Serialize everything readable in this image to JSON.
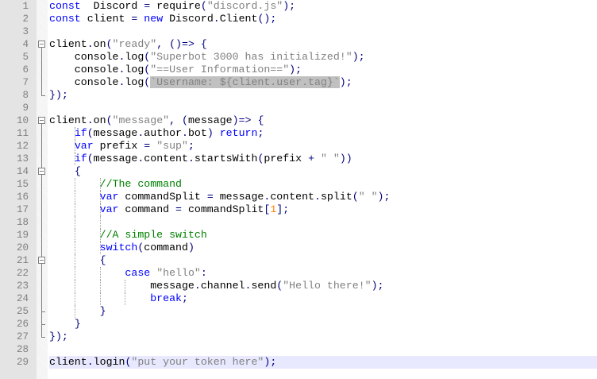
{
  "editor": {
    "current_line": 29,
    "colors": {
      "keyword": "#0000ff",
      "operator": "#000080",
      "string": "#808080",
      "comment": "#008000",
      "number": "#ff8000",
      "current_line_bg": "#e8e8ff",
      "selection": "#c0c0c0"
    },
    "lines": [
      {
        "n": "1",
        "fold": "",
        "tokens": [
          [
            "k",
            "const"
          ],
          [
            "",
            "  Discord "
          ],
          [
            "o",
            "="
          ],
          [
            "",
            " require"
          ],
          [
            "o",
            "("
          ],
          [
            "s",
            "\"discord.js\""
          ],
          [
            "o",
            ");"
          ]
        ]
      },
      {
        "n": "2",
        "fold": "",
        "tokens": [
          [
            "k",
            "const"
          ],
          [
            "",
            " client "
          ],
          [
            "o",
            "="
          ],
          [
            "",
            " "
          ],
          [
            "k",
            "new"
          ],
          [
            "",
            " Discord"
          ],
          [
            "o",
            "."
          ],
          [
            "",
            "Client"
          ],
          [
            "o",
            "();"
          ]
        ]
      },
      {
        "n": "3",
        "fold": "",
        "tokens": []
      },
      {
        "n": "4",
        "fold": "open",
        "tokens": [
          [
            "",
            "client"
          ],
          [
            "o",
            "."
          ],
          [
            "",
            "on"
          ],
          [
            "o",
            "("
          ],
          [
            "s",
            "\"ready\""
          ],
          [
            "o",
            ","
          ],
          [
            "",
            " "
          ],
          [
            "o",
            "()=>"
          ],
          [
            "",
            " "
          ],
          [
            "o",
            "{"
          ]
        ]
      },
      {
        "n": "5",
        "fold": "line",
        "tokens": [
          [
            "",
            "    console"
          ],
          [
            "o",
            "."
          ],
          [
            "",
            "log"
          ],
          [
            "o",
            "("
          ],
          [
            "s",
            "\"Superbot 3000 has initialized!\""
          ],
          [
            "o",
            ");"
          ]
        ]
      },
      {
        "n": "6",
        "fold": "line",
        "tokens": [
          [
            "",
            "    console"
          ],
          [
            "o",
            "."
          ],
          [
            "",
            "log"
          ],
          [
            "o",
            "("
          ],
          [
            "s",
            "\"==User Information==\""
          ],
          [
            "o",
            ");"
          ]
        ]
      },
      {
        "n": "7",
        "fold": "line",
        "tokens": [
          [
            "",
            "    console"
          ],
          [
            "o",
            "."
          ],
          [
            "",
            "log"
          ],
          [
            "o",
            "("
          ],
          [
            "hl s",
            "`Username: ${client.user.tag}`"
          ],
          [
            "o",
            ");"
          ]
        ]
      },
      {
        "n": "8",
        "fold": "end",
        "tokens": [
          [
            "o",
            "});"
          ]
        ]
      },
      {
        "n": "9",
        "fold": "",
        "tokens": []
      },
      {
        "n": "10",
        "fold": "open",
        "tokens": [
          [
            "",
            "client"
          ],
          [
            "o",
            "."
          ],
          [
            "",
            "on"
          ],
          [
            "o",
            "("
          ],
          [
            "s",
            "\"message\""
          ],
          [
            "o",
            ","
          ],
          [
            "",
            " "
          ],
          [
            "o",
            "("
          ],
          [
            "",
            "message"
          ],
          [
            "o",
            ")=>"
          ],
          [
            "",
            " "
          ],
          [
            "o",
            "{"
          ]
        ]
      },
      {
        "n": "11",
        "fold": "line",
        "tokens": [
          [
            "",
            "    "
          ],
          [
            "k",
            "if"
          ],
          [
            "o",
            "("
          ],
          [
            "",
            "message"
          ],
          [
            "o",
            "."
          ],
          [
            "",
            "author"
          ],
          [
            "o",
            "."
          ],
          [
            "",
            "bot"
          ],
          [
            "o",
            ")"
          ],
          [
            "",
            " "
          ],
          [
            "k",
            "return"
          ],
          [
            "o",
            ";"
          ]
        ]
      },
      {
        "n": "12",
        "fold": "line",
        "tokens": [
          [
            "",
            "    "
          ],
          [
            "k",
            "var"
          ],
          [
            "",
            " prefix "
          ],
          [
            "o",
            "="
          ],
          [
            "",
            " "
          ],
          [
            "s",
            "\"sup\""
          ],
          [
            "o",
            ";"
          ]
        ]
      },
      {
        "n": "13",
        "fold": "line",
        "tokens": [
          [
            "",
            "    "
          ],
          [
            "k",
            "if"
          ],
          [
            "o",
            "("
          ],
          [
            "",
            "message"
          ],
          [
            "o",
            "."
          ],
          [
            "",
            "content"
          ],
          [
            "o",
            "."
          ],
          [
            "",
            "startsWith"
          ],
          [
            "o",
            "("
          ],
          [
            "",
            "prefix "
          ],
          [
            "o",
            "+"
          ],
          [
            "",
            " "
          ],
          [
            "s",
            "\" \""
          ],
          [
            "o",
            "))"
          ]
        ]
      },
      {
        "n": "14",
        "fold": "open",
        "tokens": [
          [
            "",
            "    "
          ],
          [
            "o",
            "{"
          ]
        ]
      },
      {
        "n": "15",
        "fold": "line",
        "tokens": [
          [
            "",
            "        "
          ],
          [
            "c",
            "//The command"
          ]
        ]
      },
      {
        "n": "16",
        "fold": "line",
        "tokens": [
          [
            "",
            "        "
          ],
          [
            "k",
            "var"
          ],
          [
            "",
            " commandSplit "
          ],
          [
            "o",
            "="
          ],
          [
            "",
            " message"
          ],
          [
            "o",
            "."
          ],
          [
            "",
            "content"
          ],
          [
            "o",
            "."
          ],
          [
            "",
            "split"
          ],
          [
            "o",
            "("
          ],
          [
            "s",
            "\" \""
          ],
          [
            "o",
            ");"
          ]
        ]
      },
      {
        "n": "17",
        "fold": "line",
        "tokens": [
          [
            "",
            "        "
          ],
          [
            "k",
            "var"
          ],
          [
            "",
            " command "
          ],
          [
            "o",
            "="
          ],
          [
            "",
            " commandSplit"
          ],
          [
            "o",
            "["
          ],
          [
            "n",
            "1"
          ],
          [
            "o",
            "];"
          ]
        ]
      },
      {
        "n": "18",
        "fold": "line",
        "tokens": []
      },
      {
        "n": "19",
        "fold": "line",
        "tokens": [
          [
            "",
            "        "
          ],
          [
            "c",
            "//A simple switch"
          ]
        ]
      },
      {
        "n": "20",
        "fold": "line",
        "tokens": [
          [
            "",
            "        "
          ],
          [
            "k",
            "switch"
          ],
          [
            "o",
            "("
          ],
          [
            "",
            "command"
          ],
          [
            "o",
            ")"
          ]
        ]
      },
      {
        "n": "21",
        "fold": "open",
        "tokens": [
          [
            "",
            "        "
          ],
          [
            "o",
            "{"
          ]
        ]
      },
      {
        "n": "22",
        "fold": "line",
        "tokens": [
          [
            "",
            "            "
          ],
          [
            "k",
            "case"
          ],
          [
            "",
            " "
          ],
          [
            "s",
            "\"hello\""
          ],
          [
            "o",
            ":"
          ]
        ]
      },
      {
        "n": "23",
        "fold": "line",
        "tokens": [
          [
            "",
            "                message"
          ],
          [
            "o",
            "."
          ],
          [
            "",
            "channel"
          ],
          [
            "o",
            "."
          ],
          [
            "",
            "send"
          ],
          [
            "o",
            "("
          ],
          [
            "s",
            "\"Hello there!\""
          ],
          [
            "o",
            ");"
          ]
        ]
      },
      {
        "n": "24",
        "fold": "line",
        "tokens": [
          [
            "",
            "                "
          ],
          [
            "k",
            "break"
          ],
          [
            "o",
            ";"
          ]
        ]
      },
      {
        "n": "25",
        "fold": "mid",
        "tokens": [
          [
            "",
            "        "
          ],
          [
            "o",
            "}"
          ]
        ]
      },
      {
        "n": "26",
        "fold": "mid",
        "tokens": [
          [
            "",
            "    "
          ],
          [
            "o",
            "}"
          ]
        ]
      },
      {
        "n": "27",
        "fold": "end",
        "tokens": [
          [
            "o",
            "});"
          ]
        ]
      },
      {
        "n": "28",
        "fold": "",
        "tokens": []
      },
      {
        "n": "29",
        "fold": "",
        "tokens": [
          [
            "",
            "client"
          ],
          [
            "o",
            "."
          ],
          [
            "",
            "login"
          ],
          [
            "o",
            "("
          ],
          [
            "s",
            "\"put your token here\""
          ],
          [
            "o",
            ");"
          ]
        ]
      }
    ]
  }
}
